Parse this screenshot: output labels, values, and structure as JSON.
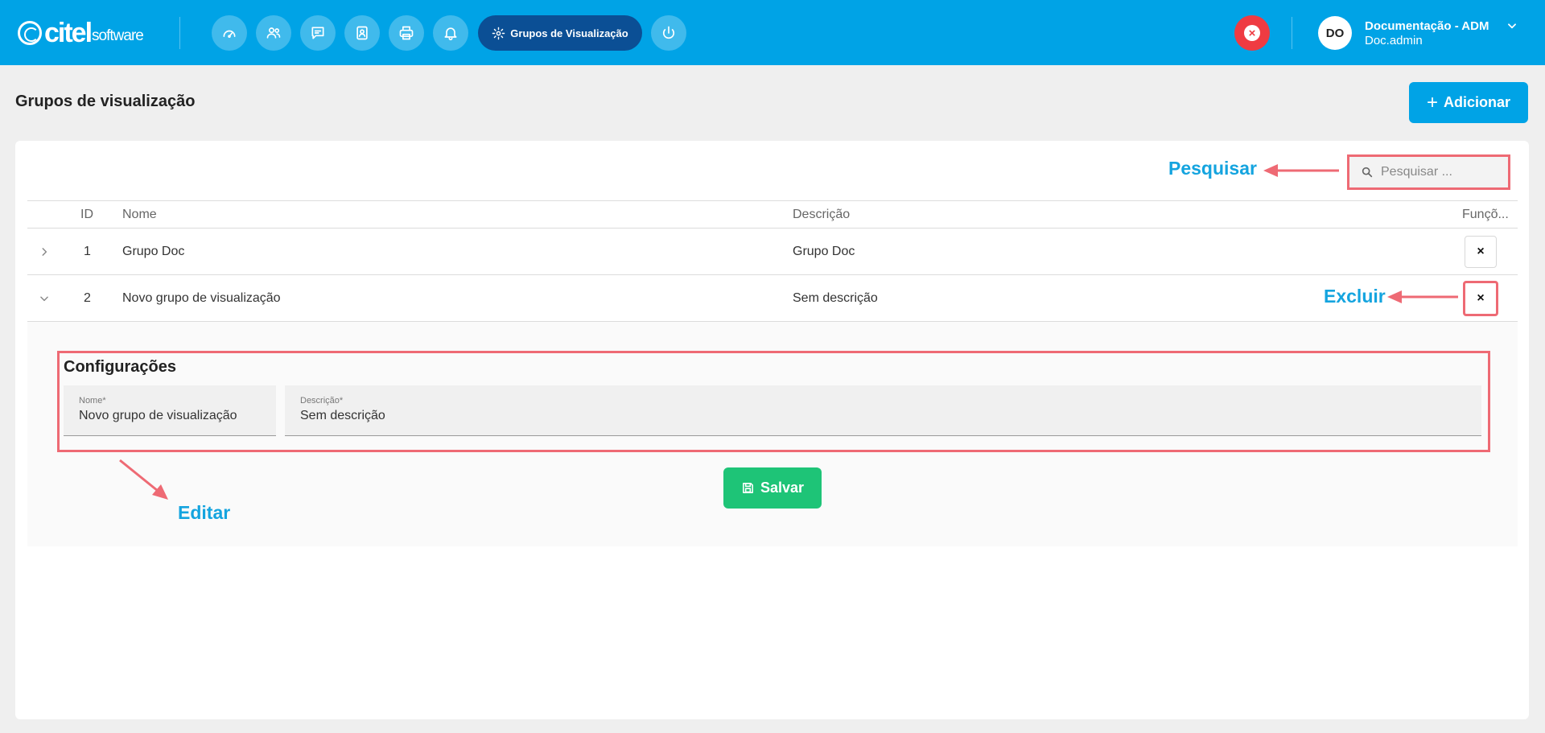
{
  "header": {
    "logo_text": "citel",
    "logo_sub": "software",
    "nav_icons": [
      "dashboard-icon",
      "users-icon",
      "chat-icon",
      "contacts-icon",
      "printer-icon",
      "bell-icon"
    ],
    "active_nav_label": "Grupos de Visualização",
    "active_nav_icon": "gear-icon",
    "power_icon": "power-icon",
    "close_icon": "close-circle-icon",
    "accent_color": "#00a3e6",
    "active_color": "#0b4f95",
    "danger_color": "#ef3b42"
  },
  "user": {
    "initials": "DO",
    "name": "Documentação - ADM",
    "login": "Doc.admin"
  },
  "page": {
    "title": "Grupos de visualização",
    "add_button_label": "Adicionar"
  },
  "search": {
    "placeholder": "Pesquisar ..."
  },
  "annotations": {
    "search": "Pesquisar",
    "delete": "Excluir",
    "edit": "Editar",
    "color": "#ee6a74"
  },
  "table": {
    "columns": [
      "ID",
      "Nome",
      "Descrição",
      "Funçõ..."
    ],
    "rows": [
      {
        "id": "1",
        "name": "Grupo Doc",
        "description": "Grupo Doc",
        "expanded": false,
        "delete_label": "×"
      },
      {
        "id": "2",
        "name": "Novo grupo de visualização",
        "description": "Sem descrição",
        "expanded": true,
        "delete_label": "×"
      }
    ]
  },
  "detail": {
    "title": "Configurações",
    "name_label": "Nome*",
    "name_value": "Novo grupo de visualização",
    "description_label": "Descrição*",
    "description_value": "Sem descrição",
    "save_label": "Salvar",
    "save_color": "#1ec477"
  }
}
